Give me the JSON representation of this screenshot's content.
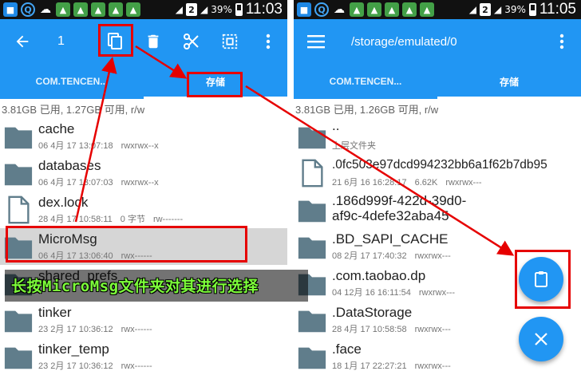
{
  "colors": {
    "accent": "#2196f3",
    "annotation": "#e60000",
    "selected_row": "#d6d6d6",
    "folder": "#607d8b"
  },
  "left": {
    "status": {
      "battery": "39%",
      "time": "11:03",
      "sim": "2"
    },
    "toolbar": {
      "selection_count": "1",
      "icons": [
        "back-arrow-icon",
        "copy-icon",
        "delete-icon",
        "cut-icon",
        "select-all-icon",
        "more-vert-icon"
      ]
    },
    "tabs": [
      "COM.TENCEN...",
      "存储"
    ],
    "storage_info": "3.81GB 已用, 1.27GB 可用, r/w",
    "items": [
      {
        "name": "cache",
        "date": "06 4月 17 13:07:18",
        "perm": "rwxrwx--x",
        "size": "",
        "type": "folder",
        "selected": false
      },
      {
        "name": "databases",
        "date": "06 4月 17 13:07:03",
        "perm": "rwxrwx--x",
        "size": "",
        "type": "folder",
        "selected": false
      },
      {
        "name": "dex.lock",
        "date": "28 4月 17 10:58:11",
        "perm": "rw-------",
        "size": "0 字节",
        "type": "file",
        "selected": false
      },
      {
        "name": "MicroMsg",
        "date": "06 4月 17 13:06:40",
        "perm": "rwx------",
        "size": "",
        "type": "folder",
        "selected": true
      },
      {
        "name": "shared_prefs",
        "date": "",
        "perm": "",
        "size": "",
        "type": "folder",
        "selected": false
      },
      {
        "name": "tinker",
        "date": "23 2月 17 10:36:12",
        "perm": "rwx------",
        "size": "",
        "type": "folder",
        "selected": false
      },
      {
        "name": "tinker_temp",
        "date": "23 2月 17 10:36:12",
        "perm": "rwx------",
        "size": "",
        "type": "folder",
        "selected": false
      }
    ]
  },
  "right": {
    "status": {
      "battery": "39%",
      "time": "11:05",
      "sim": "2"
    },
    "toolbar": {
      "path": "/storage/emulated/0",
      "icons": [
        "hamburger-menu-icon",
        "more-vert-icon"
      ]
    },
    "tabs": [
      "COM.TENCEN...",
      "存储"
    ],
    "storage_info": "3.81GB 已用, 1.26GB 可用, r/w",
    "items": [
      {
        "name": "..",
        "meta": "上层文件夹",
        "type": "folder"
      },
      {
        "name": ".0fc503e97dcd994232bb6a1f62b7db95",
        "date": "21 6月 16 16:28:17",
        "size": "6.62K",
        "perm": "rwxrwx---",
        "type": "file"
      },
      {
        "name": ".186d999f-422d-39d0-",
        "name2": "af9c-4defe32aba45",
        "type": "folder"
      },
      {
        "name": ".BD_SAPI_CACHE",
        "date": "08 2月 17 17:40:32",
        "perm": "rwxrwx---",
        "type": "folder"
      },
      {
        "name": ".com.taobao.dp",
        "date": "04 12月 16 16:11:54",
        "perm": "rwxrwx---",
        "type": "folder"
      },
      {
        "name": ".DataStorage",
        "date": "28 4月 17 10:58:58",
        "perm": "rwxrwx---",
        "type": "folder"
      },
      {
        "name": ".face",
        "date": "18 1月 17 22:27:21",
        "perm": "rwxrwx---",
        "type": "folder"
      }
    ],
    "fabs": [
      "paste-icon",
      "close-icon"
    ]
  },
  "annotation": {
    "caption": "长按MicroMsg文件夹对其进行选择"
  }
}
